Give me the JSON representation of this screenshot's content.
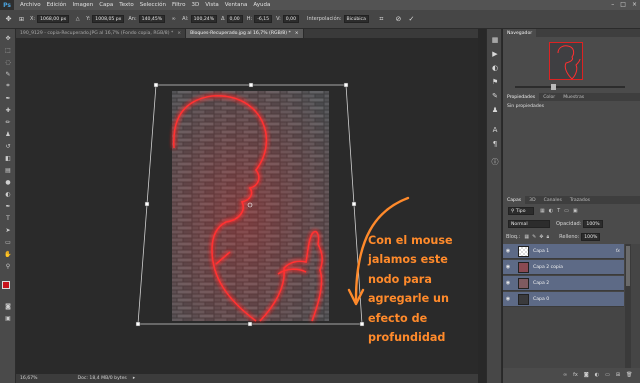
{
  "app": {
    "logo": "Ps"
  },
  "menu": [
    "Archivo",
    "Edición",
    "Imagen",
    "Capa",
    "Texto",
    "Selección",
    "Filtro",
    "3D",
    "Vista",
    "Ventana",
    "Ayuda"
  ],
  "window_controls": [
    "–",
    "□",
    "×"
  ],
  "options_bar": {
    "x_label": "X:",
    "x_value": "1068,00 px",
    "y_label": "Y:",
    "y_value": "1008,05 px",
    "w_label": "An:",
    "w_value": "140,45%",
    "h_label": "Al:",
    "h_value": "100,24%",
    "angle_label": "Δ",
    "angle_value": "0,00",
    "hskew_label": "H:",
    "hskew_value": "-6,15",
    "vskew_label": "V:",
    "vskew_value": "0,00",
    "interp_label": "Interpolación:",
    "interp_value": "Bicúbica"
  },
  "tabs": [
    {
      "label": "190_9129 - copia-Recuperado.JPG al 16,7% (Fondo copia, RGB/8) *",
      "active": false
    },
    {
      "label": "Bloques-Recuperado.jpg al 16,7% (RGB/8) *",
      "active": true
    }
  ],
  "status": {
    "zoom": "16,67%",
    "doc": "Doc: 18,4 MB/0 bytes"
  },
  "annotation": {
    "lines": [
      "Con el mouse",
      "jalamos este",
      "nodo para",
      "agregarle un",
      "efecto de",
      "profundidad"
    ],
    "color": "#ff8a2b"
  },
  "navigator": {
    "title": "Navegador"
  },
  "properties": {
    "tabs": [
      "Propiedades",
      "Color",
      "Muestras"
    ],
    "body": "Sin propiedades"
  },
  "layers_panel": {
    "tabs": [
      "Capas",
      "3D",
      "Canales",
      "Trazados"
    ],
    "kind_label": "Tipo",
    "blend_mode": "Normal",
    "opacity_label": "Opacidad:",
    "opacity_value": "100%",
    "lock_label": "Bloq.:",
    "fill_label": "Relleno:",
    "fill_value": "100%",
    "layers": [
      {
        "name": "Capa 1",
        "fx": "fx"
      },
      {
        "name": "Capa 2 copia",
        "fx": ""
      },
      {
        "name": "Capa 2",
        "fx": ""
      },
      {
        "name": "Capa 0",
        "fx": ""
      }
    ]
  },
  "colors": {
    "accent_neon": "#ff2a2a",
    "panel_selected": "#5d6a86"
  }
}
